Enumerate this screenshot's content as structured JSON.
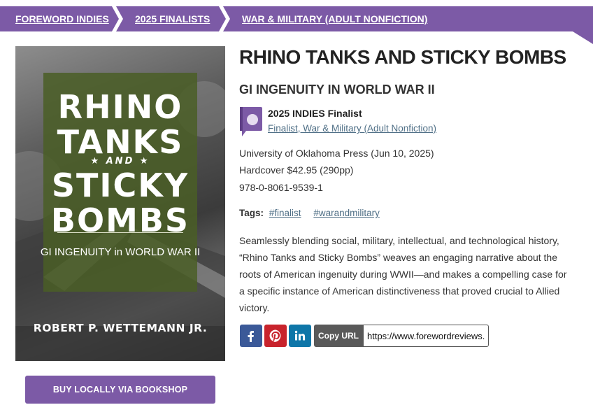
{
  "breadcrumb": {
    "items": [
      "FOREWORD INDIES",
      "2025 FINALISTS",
      "WAR & MILITARY (ADULT NONFICTION)"
    ]
  },
  "cover": {
    "title_lines": [
      "RHINO",
      "TANKS",
      "AND",
      "STICKY",
      "BOMBS"
    ],
    "subtitle": "GI INGENUITY in WORLD WAR II",
    "author": "ROBERT P. WETTEMANN JR."
  },
  "buy_button": "BUY LOCALLY VIA BOOKSHOP",
  "book": {
    "title": "RHINO TANKS AND STICKY BOMBS",
    "subtitle": "GI INGENUITY IN WORLD WAR II",
    "publisher_line": "University of Oklahoma Press (Jun 10, 2025)",
    "format_line": "Hardcover $42.95 (290pp)",
    "isbn": "978-0-8061-9539-1",
    "description": "Seamlessly blending social, military, intellectual, and technological history, “Rhino Tanks and Sticky Bombs” weaves an engaging narrative about the roots of American ingenuity during WWII—and makes a compelling case for a specific instance of American distinctiveness that proved crucial to Allied victory."
  },
  "award": {
    "title": "2025 INDIES Finalist",
    "link": "Finalist, War & Military (Adult Nonfiction)",
    "icon": "award-ribbon-icon"
  },
  "tags": {
    "label": "Tags:",
    "items": [
      "#finalist",
      "#warandmilitary"
    ]
  },
  "share": {
    "icons": [
      "facebook-icon",
      "pinterest-icon",
      "linkedin-icon"
    ],
    "copy_label": "Copy URL",
    "url_value": "https://www.forewordreviews.com"
  },
  "colors": {
    "brand_purple": "#7c5aa6",
    "link_blue": "#4f6f86",
    "facebook": "#3b5998",
    "pinterest": "#c8232c",
    "linkedin": "#0e76a8",
    "copy_label_bg": "#595959"
  }
}
